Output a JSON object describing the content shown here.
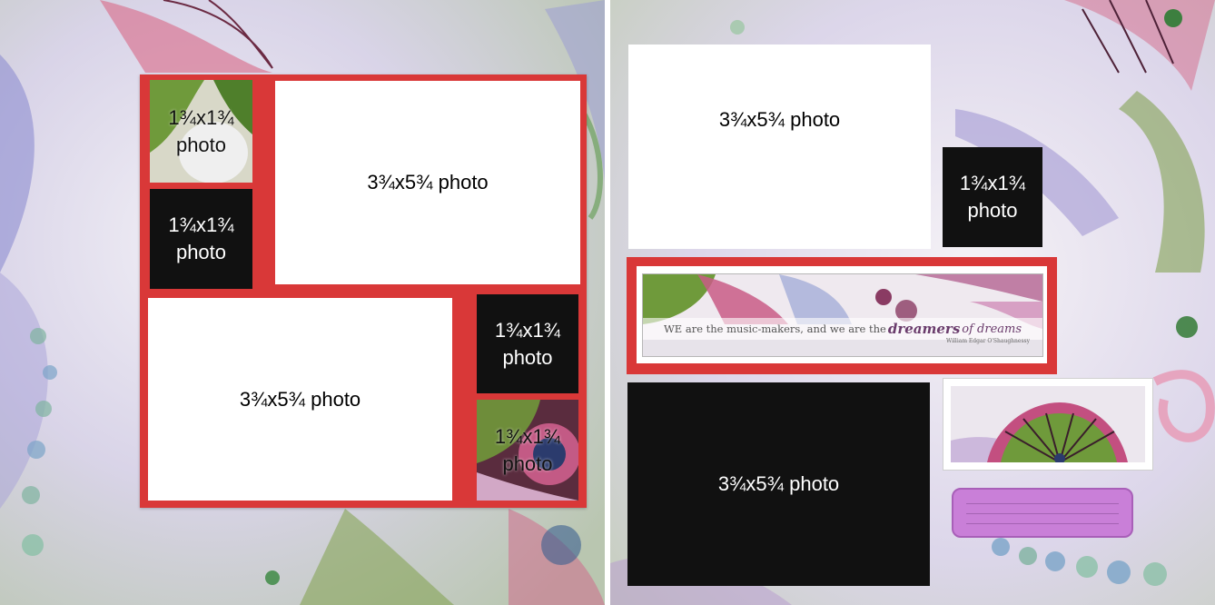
{
  "layout": {
    "left_page": {
      "slots": [
        {
          "size": "1¾x1¾",
          "word": "photo"
        },
        {
          "size": "1¾x1¾",
          "word": "photo"
        },
        {
          "size": "3¾x5¾ photo"
        },
        {
          "size": "3¾x5¾ photo"
        },
        {
          "size": "1¾x1¾",
          "word": "photo"
        },
        {
          "size": "1¾x1¾",
          "word": "photo"
        }
      ]
    },
    "right_page": {
      "slots": [
        {
          "size": "3¾x5¾ photo"
        },
        {
          "size": "1¾x1¾",
          "word": "photo"
        },
        {
          "size": "3¾x5¾ photo"
        }
      ],
      "quote": {
        "lead": "WE are the music-makers, and we are the",
        "script": "dreamers",
        "tail": "of dreams",
        "author": "William Edgar O'Shaughnessy"
      }
    }
  },
  "colors": {
    "mat": "#d93838",
    "black_mat": "#111111",
    "white_mat": "#ffffff",
    "journal_tag": "#c97fd8"
  }
}
